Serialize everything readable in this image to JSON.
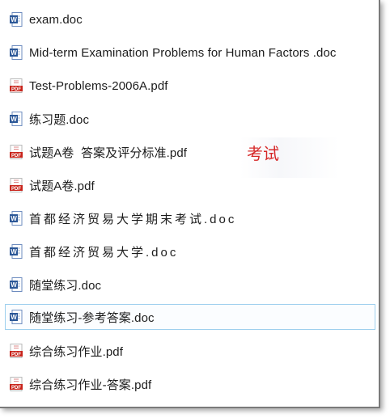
{
  "files": [
    {
      "name": "exam.doc",
      "type": "doc"
    },
    {
      "name": "Mid-term Examination Problems for Human Factors .doc",
      "type": "doc"
    },
    {
      "name": "Test-Problems-2006A.pdf",
      "type": "pdf"
    },
    {
      "name": "练习题.doc",
      "type": "doc"
    },
    {
      "name": "试题A卷  答案及评分标准.pdf",
      "type": "pdf"
    },
    {
      "name": "试题A卷.pdf",
      "type": "pdf"
    },
    {
      "name": "首都经济贸易大学期末考试.doc",
      "type": "doc"
    },
    {
      "name": "首都经济贸易大学.doc",
      "type": "doc"
    },
    {
      "name": "随堂练习.doc",
      "type": "doc"
    },
    {
      "name": "随堂练习-参考答案.doc",
      "type": "doc",
      "selected": true
    },
    {
      "name": "综合练习作业.pdf",
      "type": "pdf"
    },
    {
      "name": "综合练习作业-答案.pdf",
      "type": "pdf"
    }
  ],
  "annotation": {
    "text": "考试",
    "color": "#d62828"
  },
  "icons": {
    "doc": "word-document-icon",
    "pdf": "pdf-document-icon"
  },
  "colors": {
    "doc_icon": "#2b5797",
    "pdf_icon": "#c8251c",
    "selection_border": "#9fd0ee"
  }
}
